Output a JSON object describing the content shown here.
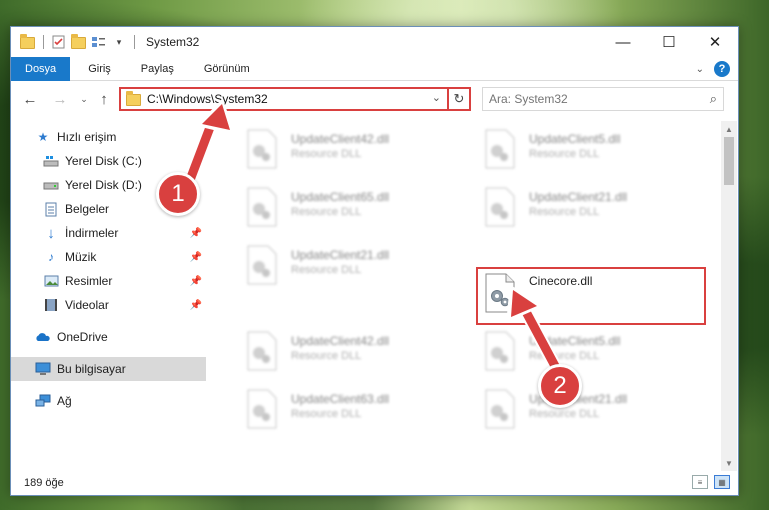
{
  "window": {
    "title": "System32",
    "controls": {
      "minimize": "—",
      "maximize": "☐",
      "close": "✕"
    }
  },
  "ribbon": {
    "tabs": [
      {
        "label": "Dosya",
        "active": true
      },
      {
        "label": "Giriş"
      },
      {
        "label": "Paylaş"
      },
      {
        "label": "Görünüm"
      }
    ],
    "help_label": "?"
  },
  "address_bar": {
    "path": "C:\\Windows\\System32",
    "search_placeholder": "Ara: System32"
  },
  "sidebar": {
    "items": [
      {
        "label": "Hızlı erişim",
        "icon": "star-icon"
      },
      {
        "label": "Yerel Disk (C:)",
        "icon": "windows-drive-icon"
      },
      {
        "label": "Yerel Disk (D:)",
        "icon": "drive-icon"
      },
      {
        "label": "Belgeler",
        "icon": "documents-icon"
      },
      {
        "label": "İndirmeler",
        "icon": "download-icon",
        "pinned": true
      },
      {
        "label": "Müzik",
        "icon": "music-icon",
        "pinned": true
      },
      {
        "label": "Resimler",
        "icon": "pictures-icon",
        "pinned": true
      },
      {
        "label": "Videolar",
        "icon": "videos-icon",
        "pinned": true
      },
      {
        "label": "OneDrive",
        "icon": "onedrive-icon"
      },
      {
        "label": "Bu bilgisayar",
        "icon": "computer-icon",
        "selected": true
      },
      {
        "label": "Ağ",
        "icon": "network-icon"
      }
    ]
  },
  "files": [
    {
      "name": "UpdateClient42.dll",
      "type": "Resource DLL",
      "blurred": true
    },
    {
      "name": "UpdateClient5.dll",
      "type": "Resource DLL",
      "blurred": true
    },
    {
      "name": "UpdateClient65.dll",
      "type": "Resource DLL",
      "blurred": true
    },
    {
      "name": "UpdateClient21.dll",
      "type": "Resource DLL",
      "blurred": true
    },
    {
      "name": "UpdateClient21.dll",
      "type": "Resource DLL",
      "blurred": true
    },
    {
      "name": "Cinecore.dll",
      "type": "",
      "blurred": false,
      "highlighted": true
    },
    {
      "name": "UpdateClient42.dll",
      "type": "Resource DLL",
      "blurred": true
    },
    {
      "name": "UpdateClient5.dll",
      "type": "Resource DLL",
      "blurred": true
    },
    {
      "name": "UpdateClient63.dll",
      "type": "Resource DLL",
      "blurred": true
    },
    {
      "name": "UpdateClient21.dll",
      "type": "Resource DLL",
      "blurred": true
    }
  ],
  "status_bar": {
    "item_count": "189 öğe"
  },
  "annotations": {
    "step1": "1",
    "step2": "2",
    "accent_color": "#d9403f"
  }
}
